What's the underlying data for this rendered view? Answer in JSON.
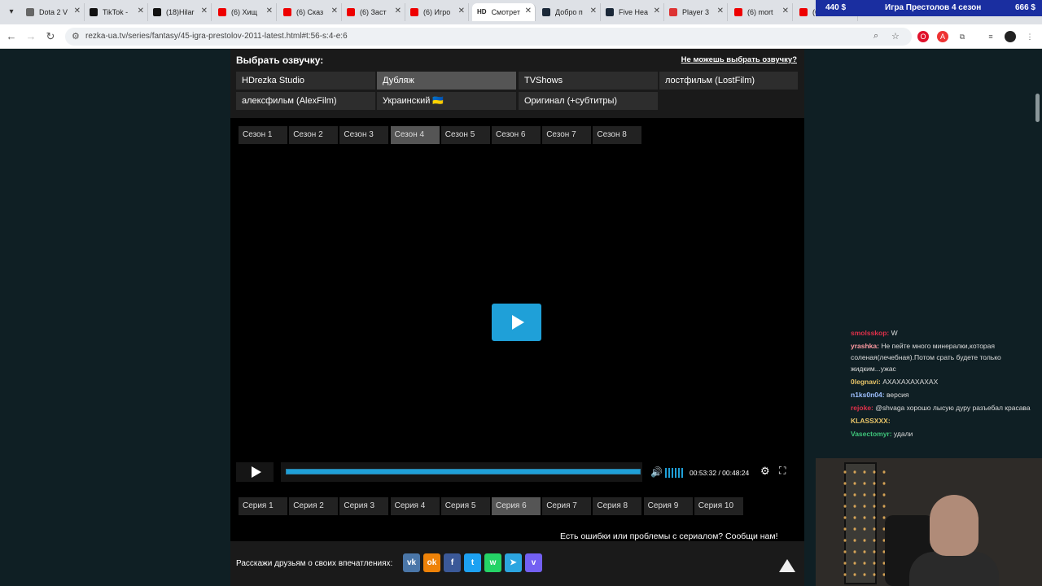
{
  "browser": {
    "tabs": [
      {
        "title": "Dota 2 V",
        "color": "#666"
      },
      {
        "title": "TikTok - ",
        "color": "#111"
      },
      {
        "title": "(18)Hilar",
        "color": "#111"
      },
      {
        "title": "(6) Хищ",
        "color": "#e00"
      },
      {
        "title": "(6) Сказ",
        "color": "#e00"
      },
      {
        "title": "(6) Заст",
        "color": "#e00"
      },
      {
        "title": "(6) Игро",
        "color": "#e00"
      },
      {
        "title": "Смотрет",
        "color": "#222"
      },
      {
        "title": "Добро п",
        "color": "#1b2838"
      },
      {
        "title": "Five Hea",
        "color": "#1b2838"
      },
      {
        "title": "Player 3",
        "color": "#d33"
      },
      {
        "title": "(6) mort",
        "color": "#e00"
      },
      {
        "title": "(6",
        "color": "#e00"
      }
    ],
    "active_tab_index": 7,
    "active_tab_badge": "HD",
    "url": "rezka-ua.tv/series/fantasy/45-igra-prestolov-2011-latest.html#t:56-s:4-e:6"
  },
  "stream_bar": {
    "left_amount": "440 $",
    "title": "Игра Престолов 4 сезон",
    "right_amount": "666 $"
  },
  "dubbing": {
    "title": "Выбрать озвучку:",
    "help_link": "Не можешь выбрать озвучку?",
    "options": [
      "HDrezka Studio",
      "Дубляж",
      "TVShows",
      "лостфильм (LostFilm)",
      "алексфильм (AlexFilm)",
      "Украинский 🇺🇦",
      "Оригинал (+субтитры)"
    ],
    "selected_index": 1
  },
  "seasons": {
    "items": [
      "Сезон 1",
      "Сезон 2",
      "Сезон 3",
      "Сезон 4",
      "Сезон 5",
      "Сезон 6",
      "Сезон 7",
      "Сезон 8"
    ],
    "selected_index": 3
  },
  "player": {
    "time": "00:53:32 / 00:48:24",
    "progress": 1.0,
    "hd_badge": "HD"
  },
  "episodes": {
    "items": [
      "Серия 1",
      "Серия 2",
      "Серия 3",
      "Серия 4",
      "Серия 5",
      "Серия 6",
      "Серия 7",
      "Серия 8",
      "Серия 9",
      "Серия 10"
    ],
    "selected_index": 5
  },
  "report_text": "Есть ошибки или проблемы с сериалом? Сообщи нам!",
  "share": {
    "label": "Расскажи друзьям о своих впечатлениях:",
    "networks": [
      {
        "icon": "vk-icon",
        "glyph": "vk",
        "color": "#4a76a8"
      },
      {
        "icon": "odnoklassniki-icon",
        "glyph": "ok",
        "color": "#ee8208"
      },
      {
        "icon": "facebook-icon",
        "glyph": "f",
        "color": "#3b5998"
      },
      {
        "icon": "twitter-icon",
        "glyph": "t",
        "color": "#1da1f2"
      },
      {
        "icon": "whatsapp-icon",
        "glyph": "w",
        "color": "#25d366"
      },
      {
        "icon": "telegram-icon",
        "glyph": "➤",
        "color": "#2ca5e0"
      },
      {
        "icon": "viber-icon",
        "glyph": "v",
        "color": "#7360f2"
      }
    ]
  },
  "chat": {
    "messages": [
      {
        "user": "smolsskop:",
        "text": " W",
        "color": "#e0304a"
      },
      {
        "user": "yrashka:",
        "text": " Не пейте много минералки,которая соленая(лечебная).Потом срать будете только жидким...ужас",
        "color": "#ff9aa2"
      },
      {
        "user": "0legnavi:",
        "text": " АХАХАХАХАХАХ",
        "color": "#e8c468"
      },
      {
        "user": "n1ks0n04:",
        "text": " версия",
        "color": "#9ec0ff"
      },
      {
        "user": "rejoke:",
        "text": " @shvaga хорошо лысую дуру разъебал красава",
        "color": "#e0304a"
      },
      {
        "user": "KLASSXXX:",
        "text": " ",
        "color": "#e8c468"
      },
      {
        "user": "Vasectomyr:",
        "text": " удали",
        "color": "#3ec47a"
      }
    ]
  }
}
